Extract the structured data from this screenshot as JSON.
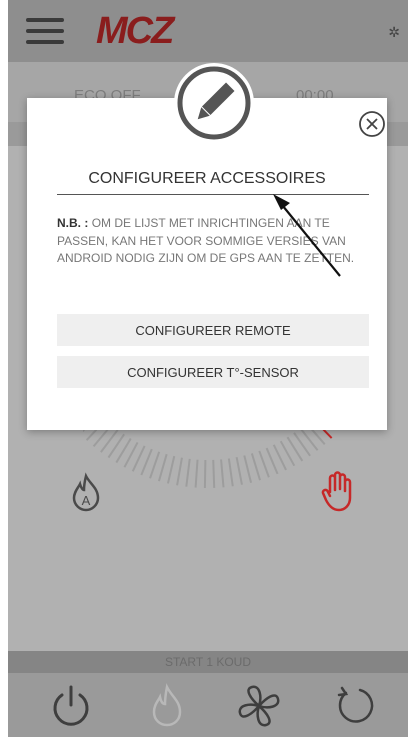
{
  "app": {
    "logo": "MCZ",
    "background_row_text_left": "ECO OFF",
    "background_row_text_right": "00:00",
    "status_text": "START 1 KOUD"
  },
  "modal": {
    "title": "CONFIGUREER ACCESSOIRES",
    "note_label": "N.B. :",
    "note_text": "OM DE LIJST MET INRICHTINGEN AAN TE PASSEN, KAN HET VOOR SOMMIGE VERSIES VAN ANDROID NODIG ZIJN OM DE GPS AAN TE ZETTEN.",
    "button_remote": "CONFIGUREER REMOTE",
    "button_sensor": "CONFIGUREER T°-SENSOR"
  },
  "icons": {
    "menu": "hamburger-menu-icon",
    "edit": "pencil-icon",
    "close": "close-circle-icon",
    "auto_flame": "auto-flame-icon",
    "manual": "hand-icon",
    "power": "power-icon",
    "flame": "flame-icon",
    "fan": "fan-icon",
    "refresh": "refresh-icon"
  },
  "colors": {
    "brand": "#8a1d1d",
    "accent_red": "#c62828",
    "overlay_gray": "#b1b1b1"
  }
}
